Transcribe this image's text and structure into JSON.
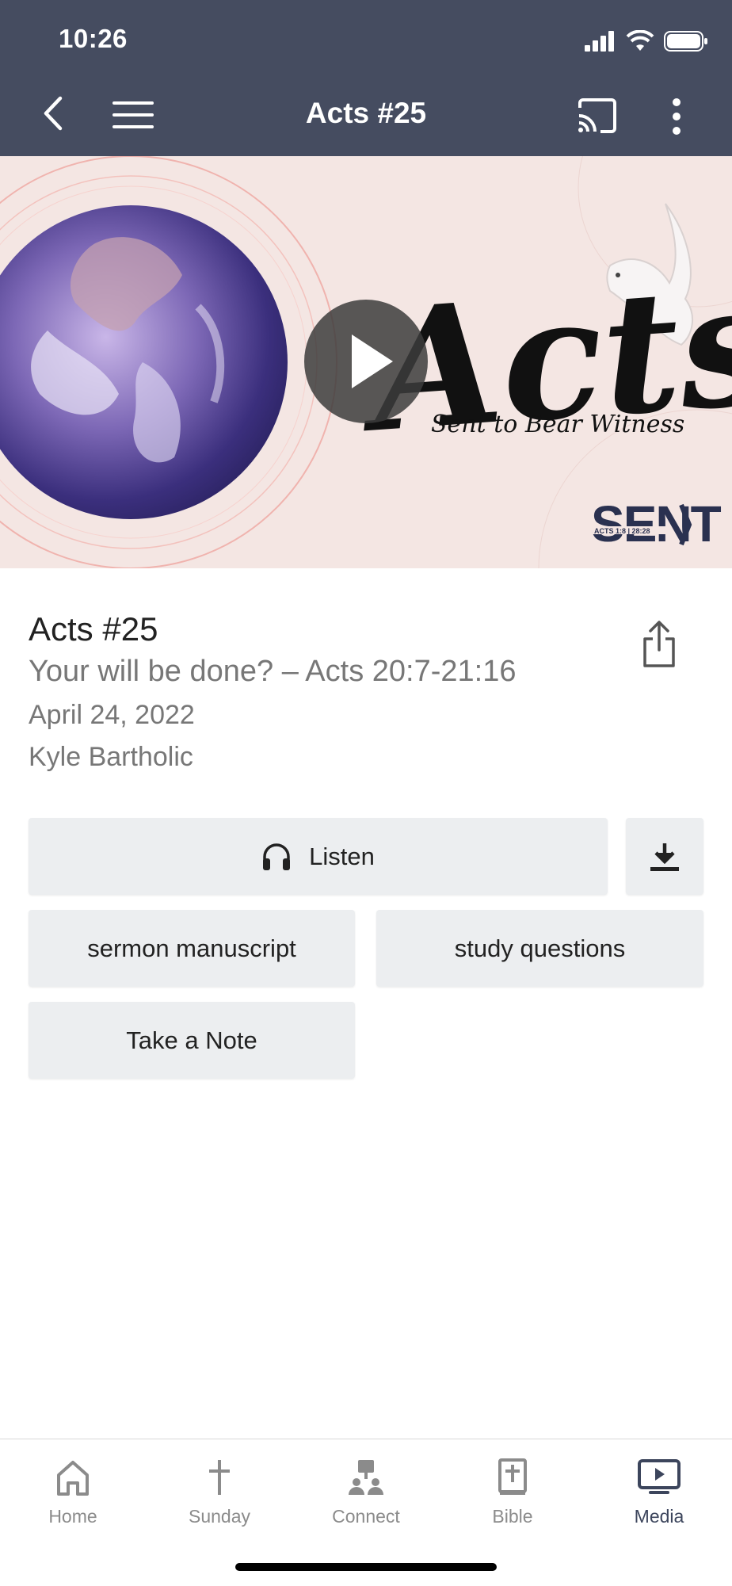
{
  "status": {
    "time": "10:26"
  },
  "header": {
    "title": "Acts #25"
  },
  "hero": {
    "script_title": "Acts",
    "tagline": "Sent to Bear Witness",
    "logo_word": "SENT",
    "logo_sub": "ACTS 1:8 | 28:28"
  },
  "sermon": {
    "title": "Acts #25",
    "subtitle": "Your will be done? – Acts 20:7-21:16",
    "date": "April 24, 2022",
    "speaker": "Kyle Bartholic"
  },
  "actions": {
    "listen": "Listen",
    "manuscript": "sermon manuscript",
    "study": "study questions",
    "note": "Take a Note"
  },
  "tabs": [
    {
      "label": "Home",
      "icon": "home-icon"
    },
    {
      "label": "Sunday",
      "icon": "cross-icon"
    },
    {
      "label": "Connect",
      "icon": "people-icon"
    },
    {
      "label": "Bible",
      "icon": "bible-icon"
    },
    {
      "label": "Media",
      "icon": "media-icon"
    }
  ],
  "colors": {
    "header": "#454c60",
    "active_tab": "#3c455c",
    "button_bg": "#eceef0"
  }
}
